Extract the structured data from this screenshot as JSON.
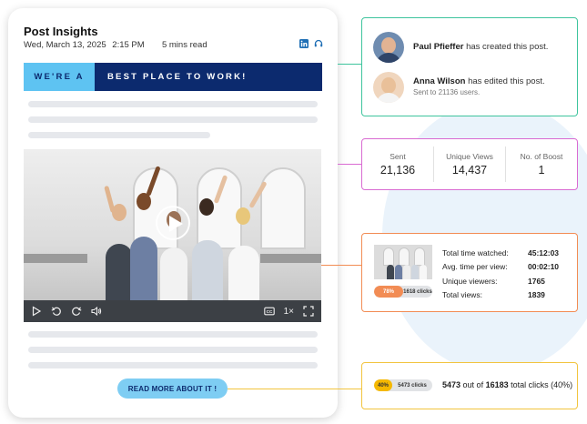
{
  "post": {
    "title": "Post Insights",
    "date": "Wed, March 13, 2025",
    "time": "2:15 PM",
    "read_time": "5 mins read",
    "banner_left": "WE'RE A",
    "banner_right": "BEST PLACE TO WORK!",
    "cta": "READ MORE ABOUT IT !",
    "video_speed": "1×"
  },
  "icons": {
    "linkedin": "linkedin-icon",
    "headset": "headset-icon",
    "play": "play-icon",
    "replay": "replay-icon",
    "forward": "forward-icon",
    "volume": "volume-icon",
    "captions": "cc-icon",
    "fullscreen": "fullscreen-icon"
  },
  "activity": {
    "entries": [
      {
        "name": "Paul Pfieffer",
        "action": "has created this post.",
        "sub": ""
      },
      {
        "name": "Anna Wilson",
        "action": "has edited this post.",
        "sub": "Sent to 21136 users."
      }
    ]
  },
  "stats": [
    {
      "label": "Sent",
      "value": "21,136"
    },
    {
      "label": "Unique Views",
      "value": "14,437"
    },
    {
      "label": "No. of Boost",
      "value": "1"
    }
  ],
  "watch": {
    "pill_pct": "78%",
    "pill_fraction": 0.78,
    "pill_clicks": "1618 clicks",
    "rows": [
      {
        "label": "Total time watched:",
        "value": "45:12:03"
      },
      {
        "label": "Avg. time per view:",
        "value": "00:02:10"
      },
      {
        "label": "Unique viewers:",
        "value": "1765"
      },
      {
        "label": "Total views:",
        "value": "1839"
      }
    ]
  },
  "clicks": {
    "pill_pct": "40%",
    "pill_fraction": 0.4,
    "pill_clicks": "5473 clicks",
    "count": "5473",
    "out_of": "out of",
    "total": "16183",
    "suffix": "total clicks (40%)"
  },
  "colors": {
    "activity_border": "#3ec49d",
    "stats_border": "#d96bd2",
    "watch_border": "#f28c54",
    "clicks_border": "#f2c43e",
    "banner_light": "#5ec3f2",
    "banner_dark": "#0c2a6e",
    "cta_bg": "#7ecdf3",
    "watch_pill": "#f28c54",
    "clicks_pill": "#f5b800"
  }
}
